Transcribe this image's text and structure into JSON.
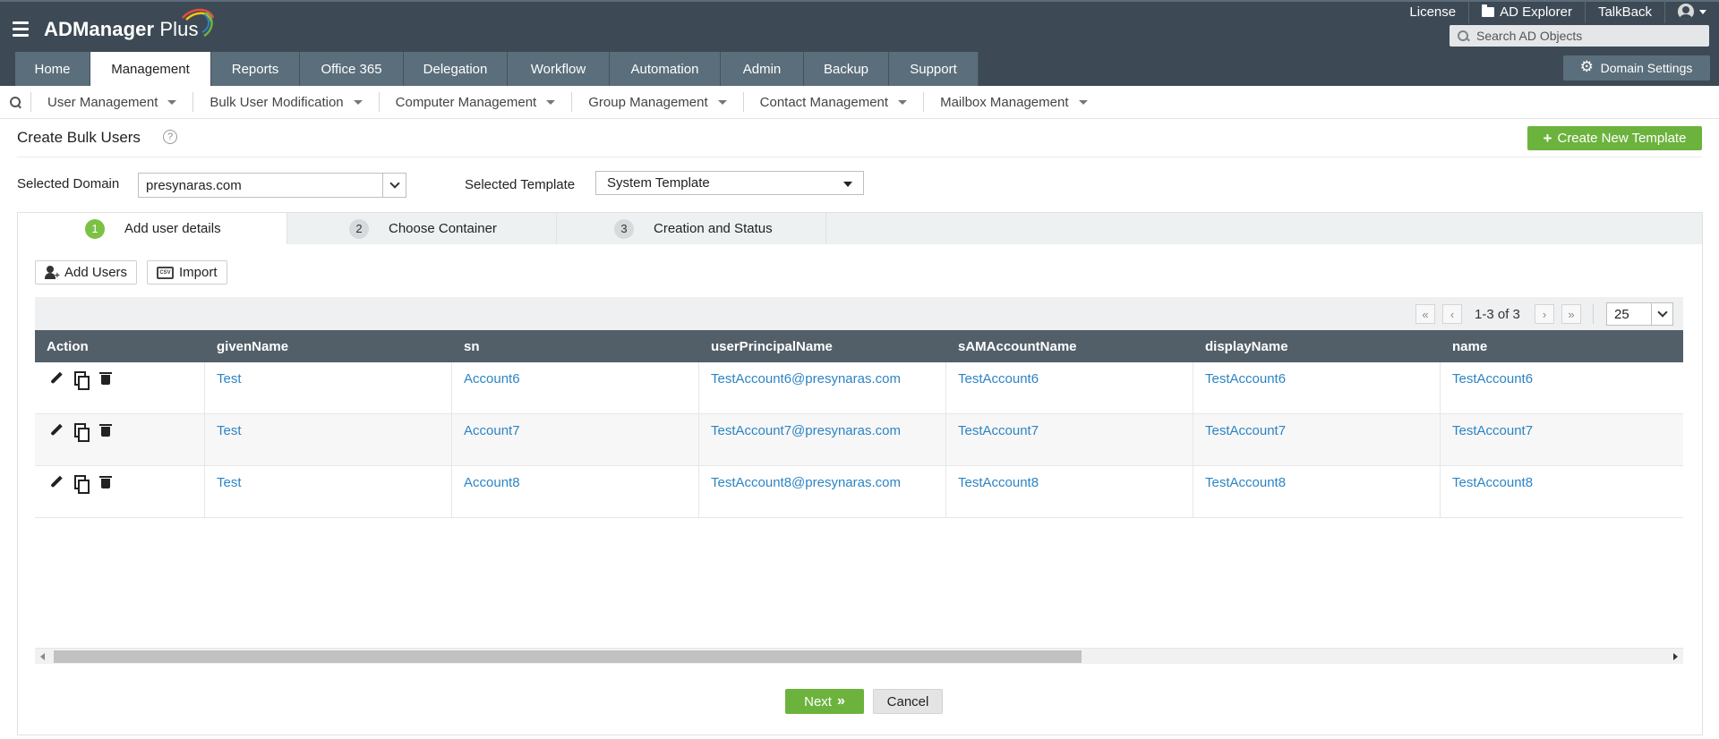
{
  "header": {
    "logo_text": "ADManager",
    "logo_plus": " Plus",
    "toplinks": [
      "License",
      "AD Explorer",
      "TalkBack"
    ],
    "search_placeholder": "Search AD Objects",
    "domain_settings": "Domain Settings"
  },
  "main_tabs": [
    "Home",
    "Management",
    "Reports",
    "Office 365",
    "Delegation",
    "Workflow",
    "Automation",
    "Admin",
    "Backup",
    "Support"
  ],
  "active_tab": "Management",
  "submenu": [
    "User Management",
    "Bulk User Modification",
    "Computer Management",
    "Group Management",
    "Contact Management",
    "Mailbox Management"
  ],
  "page": {
    "title": "Create Bulk Users",
    "help": "?",
    "create_template": "Create New Template",
    "domain_label": "Selected Domain",
    "domain_value": "presynaras.com",
    "template_label": "Selected Template",
    "template_value": "System Template"
  },
  "steps": [
    {
      "num": "1",
      "label": "Add user details"
    },
    {
      "num": "2",
      "label": "Choose Container"
    },
    {
      "num": "3",
      "label": "Creation and Status"
    }
  ],
  "toolbar": {
    "add_users": "Add Users",
    "import": "Import",
    "import_icon_text": "CSV"
  },
  "pager": {
    "info": "1-3 of 3",
    "per_page": "25"
  },
  "grid": {
    "columns": [
      "Action",
      "givenName",
      "sn",
      "userPrincipalName",
      "sAMAccountName",
      "displayName",
      "name"
    ],
    "rows": [
      [
        "Test",
        "Account6",
        "TestAccount6@presynaras.com",
        "TestAccount6",
        "TestAccount6",
        "TestAccount6"
      ],
      [
        "Test",
        "Account7",
        "TestAccount7@presynaras.com",
        "TestAccount7",
        "TestAccount7",
        "TestAccount7"
      ],
      [
        "Test",
        "Account8",
        "TestAccount8@presynaras.com",
        "TestAccount8",
        "TestAccount8",
        "TestAccount8"
      ]
    ]
  },
  "footer": {
    "next": "Next",
    "cancel": "Cancel"
  },
  "colors": {
    "header": "#3d4a55",
    "tab": "#5b6e7b",
    "green": "#6cb33e",
    "link": "#2d84c4",
    "grid_head": "#525f69"
  }
}
